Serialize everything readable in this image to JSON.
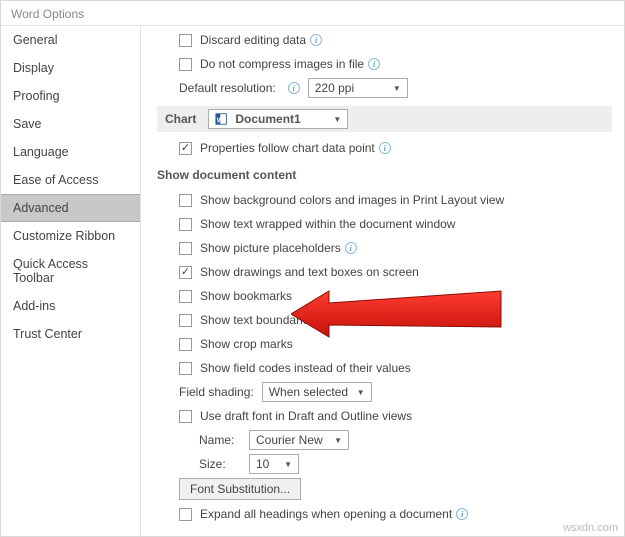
{
  "window": {
    "title": "Word Options"
  },
  "sidebar": {
    "items": [
      {
        "label": "General"
      },
      {
        "label": "Display"
      },
      {
        "label": "Proofing"
      },
      {
        "label": "Save"
      },
      {
        "label": "Language"
      },
      {
        "label": "Ease of Access"
      },
      {
        "label": "Advanced",
        "selected": true
      },
      {
        "label": "Customize Ribbon"
      },
      {
        "label": "Quick Access Toolbar"
      },
      {
        "label": "Add-ins"
      },
      {
        "label": "Trust Center"
      }
    ]
  },
  "content": {
    "discard_editing": "Discard editing data",
    "no_compress": "Do not compress images in file",
    "default_res_label": "Default resolution:",
    "default_res_value": "220 ppi",
    "chart_label": "Chart",
    "chart_doc": "Document1",
    "props_follow": "Properties follow chart data point",
    "section_show": "Show document content",
    "show_bg": "Show background colors and images in Print Layout view",
    "show_wrap": "Show text wrapped within the document window",
    "show_placeholders": "Show picture placeholders",
    "show_drawings": "Show drawings and text boxes on screen",
    "show_bookmarks": "Show bookmarks",
    "show_boundaries": "Show text boundaries",
    "show_crop": "Show crop marks",
    "show_fieldcodes": "Show field codes instead of their values",
    "field_shading_label": "Field shading:",
    "field_shading_value": "When selected",
    "use_draft": "Use draft font in Draft and Outline views",
    "name_label": "Name:",
    "name_value": "Courier New",
    "size_label": "Size:",
    "size_value": "10",
    "font_sub": "Font Substitution...",
    "expand_all": "Expand all headings when opening a document"
  },
  "watermark": "wsxdn.com"
}
